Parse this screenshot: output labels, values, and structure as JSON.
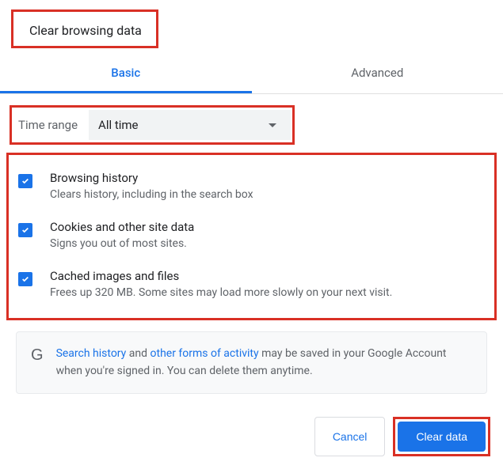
{
  "dialog": {
    "title": "Clear browsing data"
  },
  "tabs": {
    "basic": "Basic",
    "advanced": "Advanced"
  },
  "timeRange": {
    "label": "Time range",
    "value": "All time"
  },
  "options": [
    {
      "label": "Browsing history",
      "desc": "Clears history, including in the search box",
      "checked": true
    },
    {
      "label": "Cookies and other site data",
      "desc": "Signs you out of most sites.",
      "checked": true
    },
    {
      "label": "Cached images and files",
      "desc": "Frees up 320 MB. Some sites may load more slowly on your next visit.",
      "checked": true
    }
  ],
  "info": {
    "link1": "Search history",
    "mid1": " and ",
    "link2": "other forms of activity",
    "rest": " may be saved in your Google Account when you're signed in. You can delete them anytime."
  },
  "buttons": {
    "cancel": "Cancel",
    "clear": "Clear data"
  }
}
